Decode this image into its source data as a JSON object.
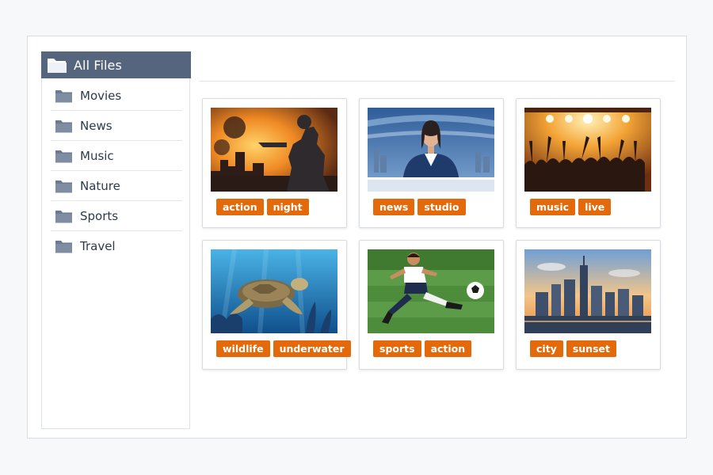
{
  "sidebar": {
    "header": {
      "label": "All Files",
      "icon": "folder-open-icon"
    },
    "items": [
      {
        "label": "Movies",
        "icon": "folder-icon"
      },
      {
        "label": "News",
        "icon": "folder-icon"
      },
      {
        "label": "Music",
        "icon": "folder-icon"
      },
      {
        "label": "Nature",
        "icon": "folder-icon"
      },
      {
        "label": "Sports",
        "icon": "folder-icon"
      },
      {
        "label": "Travel",
        "icon": "folder-icon"
      }
    ]
  },
  "gallery": {
    "cards": [
      {
        "scene": "action-silhouette-explosion",
        "tags": [
          "action",
          "night"
        ]
      },
      {
        "scene": "news-anchor-studio",
        "tags": [
          "news",
          "studio"
        ]
      },
      {
        "scene": "concert-crowd",
        "tags": [
          "music",
          "live"
        ]
      },
      {
        "scene": "sea-turtle-underwater",
        "tags": [
          "wildlife",
          "underwater"
        ]
      },
      {
        "scene": "soccer-player-kick",
        "tags": [
          "sports",
          "action"
        ]
      },
      {
        "scene": "city-skyline-sunset",
        "tags": [
          "city",
          "sunset"
        ]
      }
    ]
  },
  "colors": {
    "sidebar_header": "#55657d",
    "folder": "#6b7a90",
    "tag": "#e4690b",
    "text": "#2c3a4b"
  }
}
